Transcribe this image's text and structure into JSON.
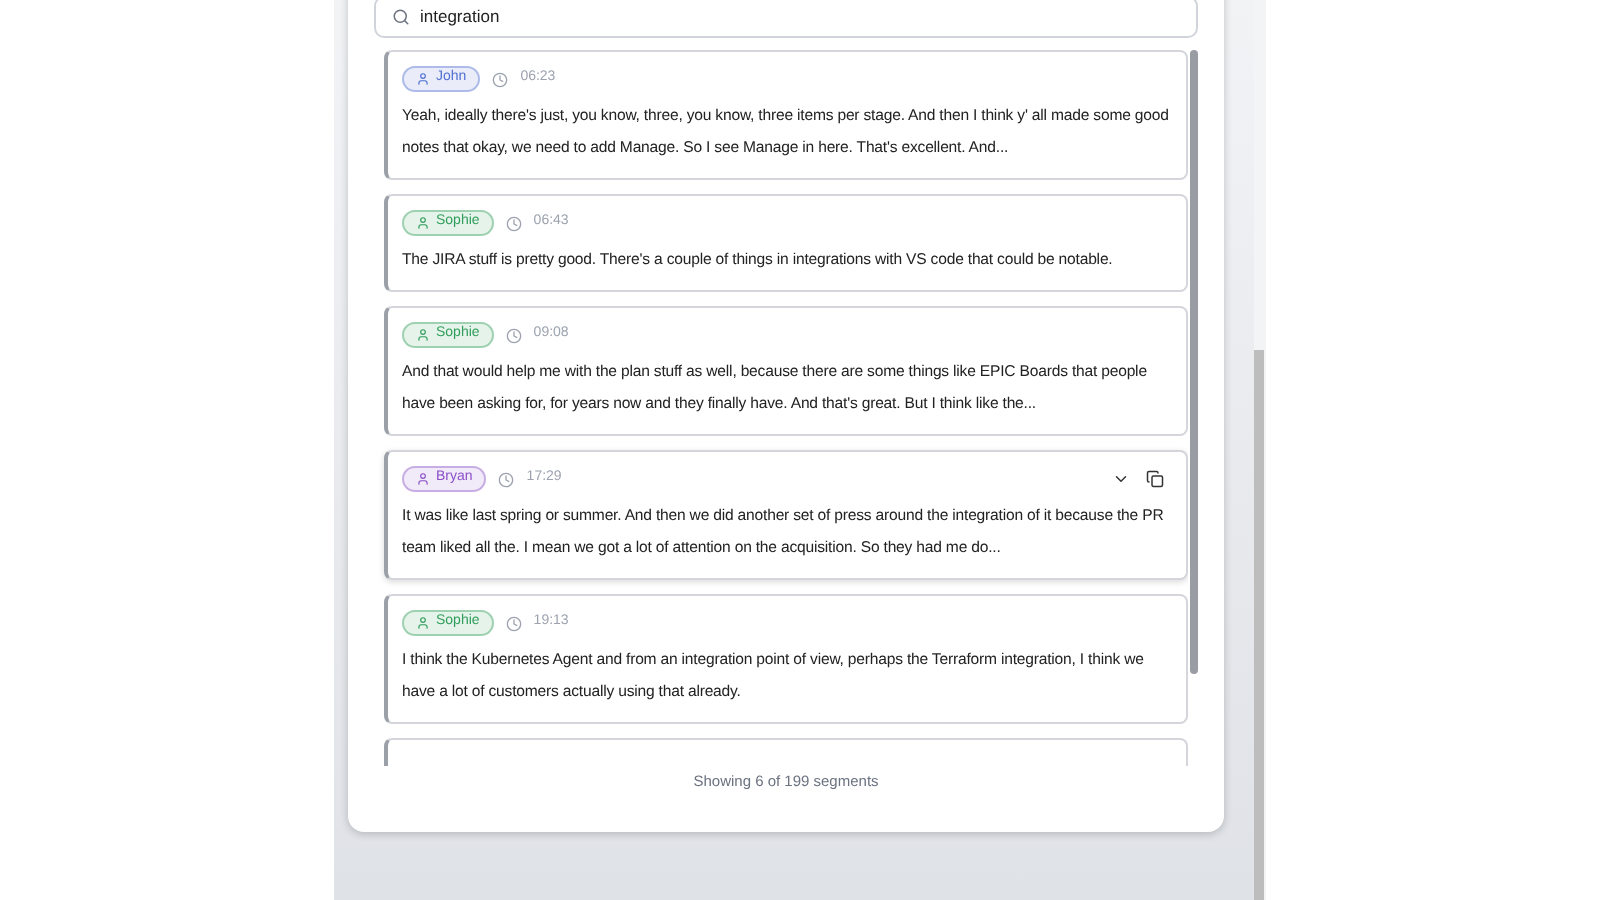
{
  "search": {
    "value": "integration"
  },
  "segments": [
    {
      "speaker": "John",
      "color": "#4f6fd1",
      "time": "06:23",
      "hovered": false,
      "text": "Yeah, ideally there's just, you know, three, you know, three items per stage. And then I think y' all made some good notes that okay, we need to add Manage. So I see Manage in here. That's excellent. And..."
    },
    {
      "speaker": "Sophie",
      "color": "#2f9e5a",
      "time": "06:43",
      "hovered": false,
      "text": "The JIRA stuff is pretty good. There's a couple of things in integrations with VS code that could be notable."
    },
    {
      "speaker": "Sophie",
      "color": "#2f9e5a",
      "time": "09:08",
      "hovered": false,
      "text": "And that would help me with the plan stuff as well, because there are some things like EPIC Boards that people have been asking for, for years now and they finally have. And that's great. But I think like the..."
    },
    {
      "speaker": "Bryan",
      "color": "#8a4fc9",
      "time": "17:29",
      "hovered": true,
      "text": "It was like last spring or summer. And then we did another set of press around the integration of it because the PR team liked all the. I mean we got a lot of attention on the acquisition. So they had me do..."
    },
    {
      "speaker": "Sophie",
      "color": "#2f9e5a",
      "time": "19:13",
      "hovered": false,
      "text": "I think the Kubernetes Agent and from an integration point of view, perhaps the Terraform integration, I think we have a lot of customers actually using that already."
    }
  ],
  "footer": "Showing 6 of 199 segments"
}
